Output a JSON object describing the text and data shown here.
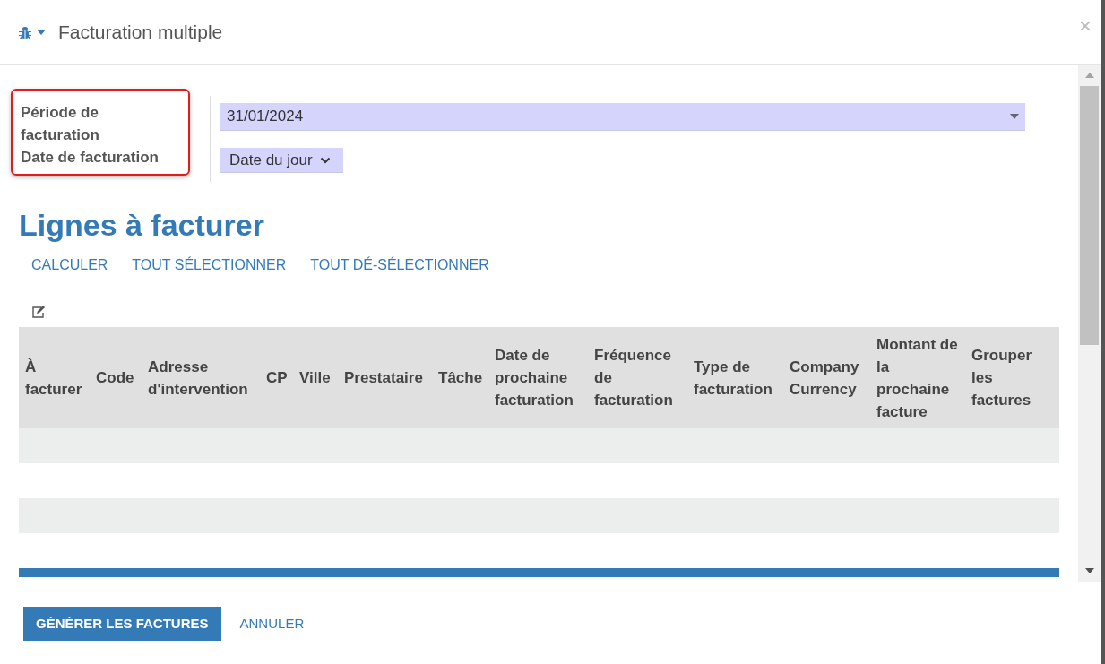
{
  "window": {
    "title": "Facturation multiple",
    "close": "×"
  },
  "form": {
    "labels": [
      "Période de facturation",
      "Date de facturation"
    ],
    "period_value": "31/01/2024",
    "date_option": "Date du jour"
  },
  "section": {
    "title": "Lignes à facturer",
    "actions": [
      "CALCULER",
      "TOUT SÉLECTIONNER",
      "TOUT DÉ-SÉLECTIONNER"
    ]
  },
  "table": {
    "columns": [
      "À facturer",
      "Code",
      "Adresse d'intervention",
      "CP",
      "Ville",
      "Prestataire",
      "Tâche",
      "Date de prochaine facturation",
      "Fréquence de facturation",
      "Type de facturation",
      "Company Currency",
      "Montant de la prochaine facture",
      "Grouper les factures"
    ]
  },
  "footer": {
    "buttons": [
      {
        "label": "GÉNÉRER LES FACTURES",
        "kind": "primary"
      },
      {
        "label": "ANNULER",
        "kind": "link"
      }
    ]
  }
}
